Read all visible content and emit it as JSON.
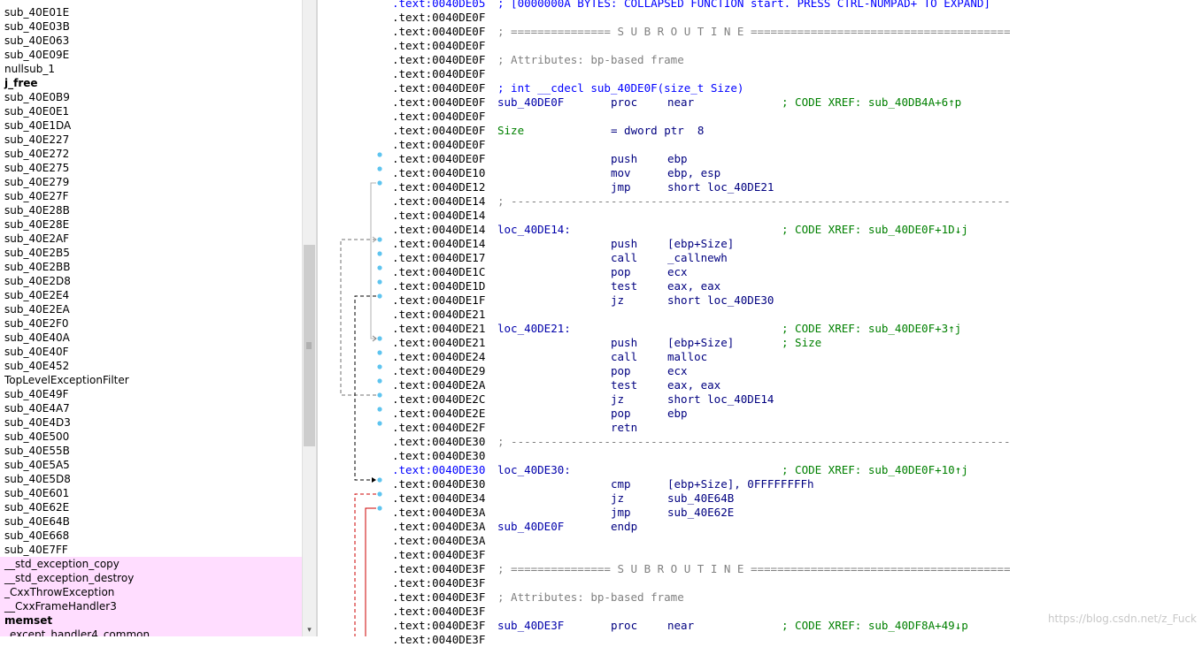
{
  "function_list": {
    "items": [
      {
        "name": "sub_40E01E"
      },
      {
        "name": "sub_40E03B"
      },
      {
        "name": "sub_40E063"
      },
      {
        "name": "sub_40E09E"
      },
      {
        "name": "nullsub_1"
      },
      {
        "name": "j_free",
        "bold": true
      },
      {
        "name": "sub_40E0B9"
      },
      {
        "name": "sub_40E0E1"
      },
      {
        "name": "sub_40E1DA"
      },
      {
        "name": "sub_40E227"
      },
      {
        "name": "sub_40E272"
      },
      {
        "name": "sub_40E275"
      },
      {
        "name": "sub_40E279"
      },
      {
        "name": "sub_40E27F"
      },
      {
        "name": "sub_40E28B"
      },
      {
        "name": "sub_40E28E"
      },
      {
        "name": "sub_40E2AF"
      },
      {
        "name": "sub_40E2B5"
      },
      {
        "name": "sub_40E2BB"
      },
      {
        "name": "sub_40E2D8"
      },
      {
        "name": "sub_40E2E4"
      },
      {
        "name": "sub_40E2EA"
      },
      {
        "name": "sub_40E2F0"
      },
      {
        "name": "sub_40E40A"
      },
      {
        "name": "sub_40E40F"
      },
      {
        "name": "sub_40E452"
      },
      {
        "name": "TopLevelExceptionFilter"
      },
      {
        "name": "sub_40E49F"
      },
      {
        "name": "sub_40E4A7"
      },
      {
        "name": "sub_40E4D3"
      },
      {
        "name": "sub_40E500"
      },
      {
        "name": "sub_40E55B"
      },
      {
        "name": "sub_40E5A5"
      },
      {
        "name": "sub_40E5D8"
      },
      {
        "name": "sub_40E601"
      },
      {
        "name": "sub_40E62E"
      },
      {
        "name": "sub_40E64B"
      },
      {
        "name": "sub_40E668"
      },
      {
        "name": "sub_40E7FF"
      },
      {
        "name": "__std_exception_copy",
        "lib": true
      },
      {
        "name": "__std_exception_destroy",
        "lib": true
      },
      {
        "name": "_CxxThrowException",
        "lib": true
      },
      {
        "name": "__CxxFrameHandler3",
        "lib": true
      },
      {
        "name": "memset",
        "lib": true,
        "bold": true
      },
      {
        "name": "_except_handler4_common",
        "lib": true
      }
    ],
    "scrollbar": {
      "down_arrow": "▾"
    }
  },
  "disassembly": {
    "lines": [
      {
        "addr": ".text:0040DE05",
        "hl": true,
        "top": "; [0000000A BYTES: COLLAPSED FUNCTION start. PRESS CTRL-NUMPAD+ TO EXPAND]"
      },
      {
        "addr": ".text:0040DE0F"
      },
      {
        "addr": ".text:0040DE0F",
        "sep": "; =============== S U B R O U T I N E ======================================="
      },
      {
        "addr": ".text:0040DE0F"
      },
      {
        "addr": ".text:0040DE0F",
        "cmt": "; Attributes: bp-based frame"
      },
      {
        "addr": ".text:0040DE0F"
      },
      {
        "addr": ".text:0040DE0F",
        "decl": "; int __cdecl sub_40DE0F(size_t Size)"
      },
      {
        "addr": ".text:0040DE0F",
        "label": "sub_40DE0F",
        "mnem": "proc",
        "opnd": "near",
        "xref": "; CODE XREF: sub_40DB4A+6↑p"
      },
      {
        "addr": ".text:0040DE0F"
      },
      {
        "addr": ".text:0040DE0F",
        "var": "Size",
        "opnd_wide": "= dword ptr  8"
      },
      {
        "addr": ".text:0040DE0F"
      },
      {
        "addr": ".text:0040DE0F",
        "mnem": "push",
        "opnd": "ebp"
      },
      {
        "addr": ".text:0040DE10",
        "mnem": "mov",
        "opnd": "ebp, esp"
      },
      {
        "addr": ".text:0040DE12",
        "mnem": "jmp",
        "opnd": "short loc_40DE21"
      },
      {
        "addr": ".text:0040DE14",
        "sep": "; ---------------------------------------------------------------------------"
      },
      {
        "addr": ".text:0040DE14"
      },
      {
        "addr": ".text:0040DE14",
        "label": "loc_40DE14:",
        "xref": "; CODE XREF: sub_40DE0F+1D↓j"
      },
      {
        "addr": ".text:0040DE14",
        "mnem": "push",
        "opnd": "[ebp+Size]"
      },
      {
        "addr": ".text:0040DE17",
        "mnem": "call",
        "opnd": "_callnewh"
      },
      {
        "addr": ".text:0040DE1C",
        "mnem": "pop",
        "opnd": "ecx"
      },
      {
        "addr": ".text:0040DE1D",
        "mnem": "test",
        "opnd": "eax, eax"
      },
      {
        "addr": ".text:0040DE1F",
        "mnem": "jz",
        "opnd": "short loc_40DE30"
      },
      {
        "addr": ".text:0040DE21"
      },
      {
        "addr": ".text:0040DE21",
        "label": "loc_40DE21:",
        "xref": "; CODE XREF: sub_40DE0F+3↑j"
      },
      {
        "addr": ".text:0040DE21",
        "mnem": "push",
        "opnd": "[ebp+Size]",
        "xref": "; Size"
      },
      {
        "addr": ".text:0040DE24",
        "mnem": "call",
        "opnd": "malloc"
      },
      {
        "addr": ".text:0040DE29",
        "mnem": "pop",
        "opnd": "ecx"
      },
      {
        "addr": ".text:0040DE2A",
        "mnem": "test",
        "opnd": "eax, eax"
      },
      {
        "addr": ".text:0040DE2C",
        "mnem": "jz",
        "opnd": "short loc_40DE14"
      },
      {
        "addr": ".text:0040DE2E",
        "mnem": "pop",
        "opnd": "ebp"
      },
      {
        "addr": ".text:0040DE2F",
        "mnem": "retn"
      },
      {
        "addr": ".text:0040DE30",
        "sep": "; ---------------------------------------------------------------------------"
      },
      {
        "addr": ".text:0040DE30"
      },
      {
        "addr": ".text:0040DE30",
        "hl": true,
        "label": "loc_40DE30:",
        "xref": "; CODE XREF: sub_40DE0F+10↑j"
      },
      {
        "addr": ".text:0040DE30",
        "mnem": "cmp",
        "opnd": "[ebp+Size], 0FFFFFFFFh"
      },
      {
        "addr": ".text:0040DE34",
        "mnem": "jz",
        "opnd": "sub_40E64B"
      },
      {
        "addr": ".text:0040DE3A",
        "mnem": "jmp",
        "opnd": "sub_40E62E"
      },
      {
        "addr": ".text:0040DE3A",
        "label": "sub_40DE0F",
        "mnem": "endp"
      },
      {
        "addr": ".text:0040DE3A"
      },
      {
        "addr": ".text:0040DE3F"
      },
      {
        "addr": ".text:0040DE3F",
        "sep": "; =============== S U B R O U T I N E ======================================="
      },
      {
        "addr": ".text:0040DE3F"
      },
      {
        "addr": ".text:0040DE3F",
        "cmt": "; Attributes: bp-based frame"
      },
      {
        "addr": ".text:0040DE3F"
      },
      {
        "addr": ".text:0040DE3F",
        "label": "sub_40DE3F",
        "mnem": "proc",
        "opnd": "near",
        "xref": "; CODE XREF: sub_40DF8A+49↓p"
      },
      {
        "addr": ".text:0040DE3F"
      }
    ]
  },
  "colors": {
    "address": "#000000",
    "address_highlight": "#0000ff",
    "label": "#0000aa",
    "instruction": "#000080",
    "xref_comment": "#008000",
    "gray_comment": "#808080",
    "library_function_bg": "#ffddff",
    "breakpoint_dot": "#5ec4ef"
  },
  "watermark": "https://blog.csdn.net/z_Fuck"
}
